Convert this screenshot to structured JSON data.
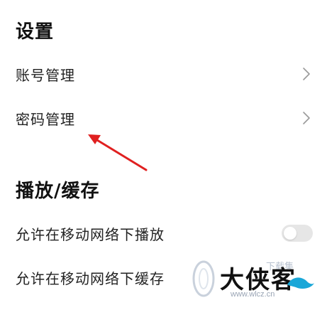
{
  "settings": {
    "title": "设置",
    "items": [
      {
        "label": "账号管理"
      },
      {
        "label": "密码管理"
      }
    ]
  },
  "playback": {
    "title": "播放/缓存",
    "items": [
      {
        "label": "允许在移动网络下播放",
        "toggle": "off"
      },
      {
        "label": "允许在移动网络下缓存"
      }
    ]
  },
  "icons": {
    "chevron": "chevron-right-icon",
    "arrow": "red-arrow-annotation-icon",
    "watermark": "daxiake-logo"
  },
  "watermark": {
    "text": "大侠客",
    "small": "下载集",
    "sub": "www.wlcz.cn"
  },
  "colors": {
    "arrow": "#e02020",
    "toggle_off": "#e6e6e6",
    "chevron": "#9a9a9a"
  }
}
